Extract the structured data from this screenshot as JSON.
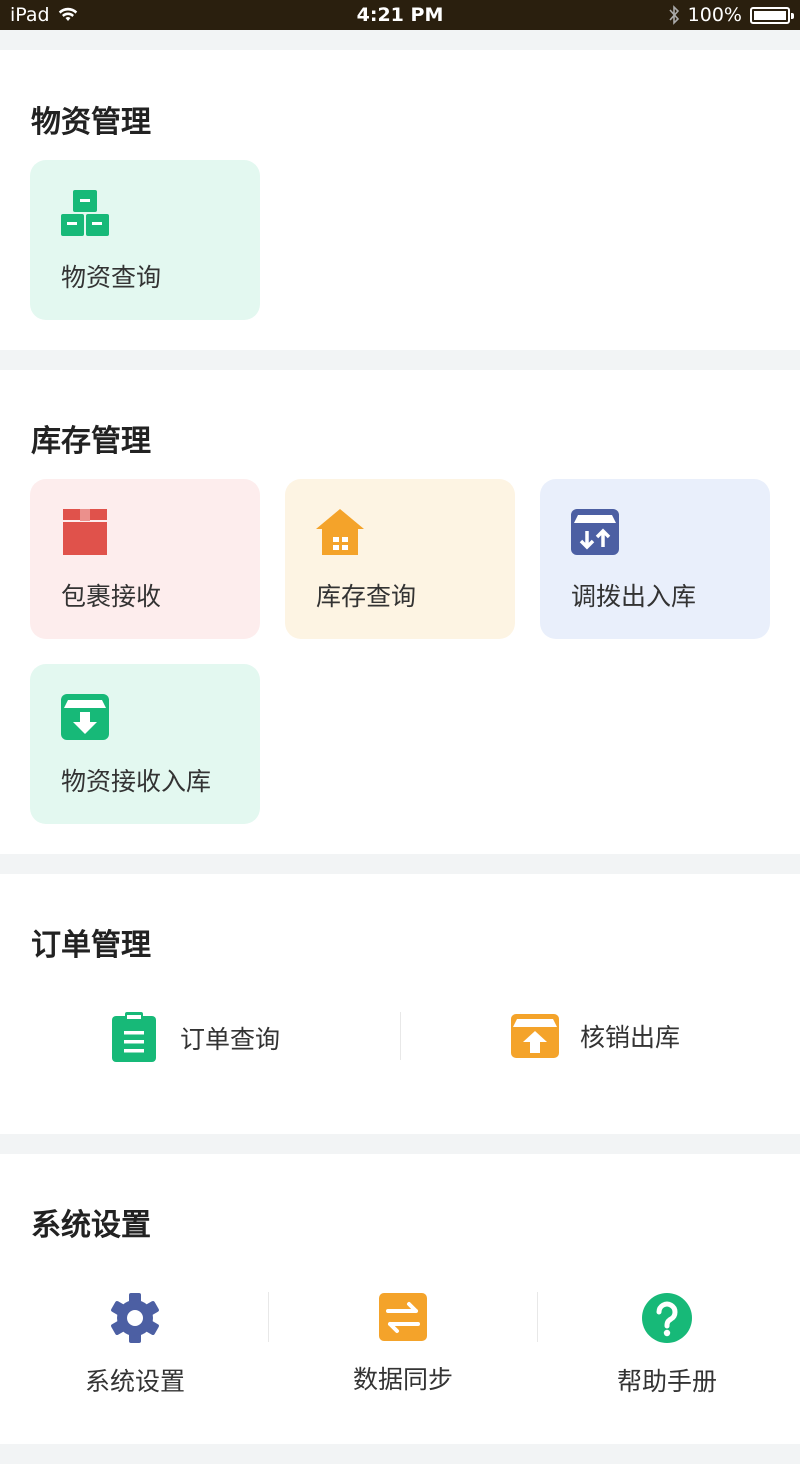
{
  "status_bar": {
    "device": "iPad",
    "time": "4:21 PM",
    "battery": "100%"
  },
  "sections": {
    "materials": {
      "title": "物资管理",
      "items": [
        {
          "label": "物资查询",
          "icon": "boxes-icon",
          "color": "#17b978"
        }
      ]
    },
    "inventory": {
      "title": "库存管理",
      "items": [
        {
          "label": "包裹接收",
          "icon": "package-icon",
          "color": "#e0524b"
        },
        {
          "label": "库存查询",
          "icon": "warehouse-icon",
          "color": "#f4a32a"
        },
        {
          "label": "调拨出入库",
          "icon": "transfer-box-icon",
          "color": "#4c5fa3"
        },
        {
          "label": "物资接收入库",
          "icon": "inbox-download-icon",
          "color": "#17b978"
        }
      ]
    },
    "orders": {
      "title": "订单管理",
      "items": [
        {
          "label": "订单查询",
          "icon": "clipboard-icon",
          "color": "#17b978"
        },
        {
          "label": "核销出库",
          "icon": "outbound-box-icon",
          "color": "#f4a32a"
        }
      ]
    },
    "system": {
      "title": "系统设置",
      "items": [
        {
          "label": "系统设置",
          "icon": "gear-icon",
          "color": "#4c5fa3"
        },
        {
          "label": "数据同步",
          "icon": "sync-arrows-icon",
          "color": "#f4a32a"
        },
        {
          "label": "帮助手册",
          "icon": "help-icon",
          "color": "#17b978"
        }
      ]
    }
  }
}
